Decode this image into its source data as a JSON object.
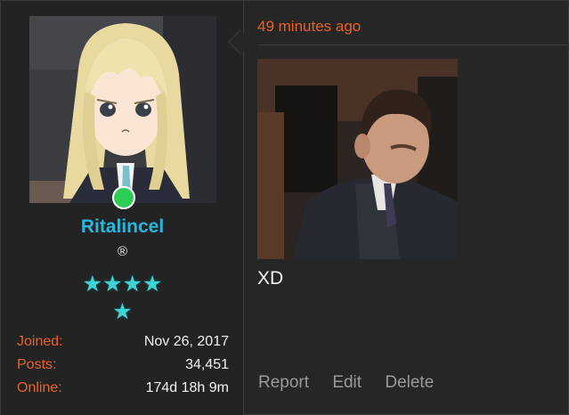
{
  "user": {
    "username": "Ritalincel",
    "registered_mark": "®",
    "stars_row1": "★★★★",
    "stars_row2": "★",
    "online_status": "online",
    "stats": {
      "joined_label": "Joined:",
      "joined_value": "Nov 26, 2017",
      "posts_label": "Posts:",
      "posts_value": "34,451",
      "online_label": "Online:",
      "online_value": "174d 18h 9m"
    }
  },
  "post": {
    "timestamp": "49 minutes ago",
    "message": "XD",
    "actions": {
      "report": "Report",
      "edit": "Edit",
      "delete": "Delete"
    }
  },
  "colors": {
    "accent_orange": "#e8622a",
    "username_blue": "#29b6dc",
    "star_teal": "#3fd3d3",
    "online_green": "#2ecc55"
  }
}
